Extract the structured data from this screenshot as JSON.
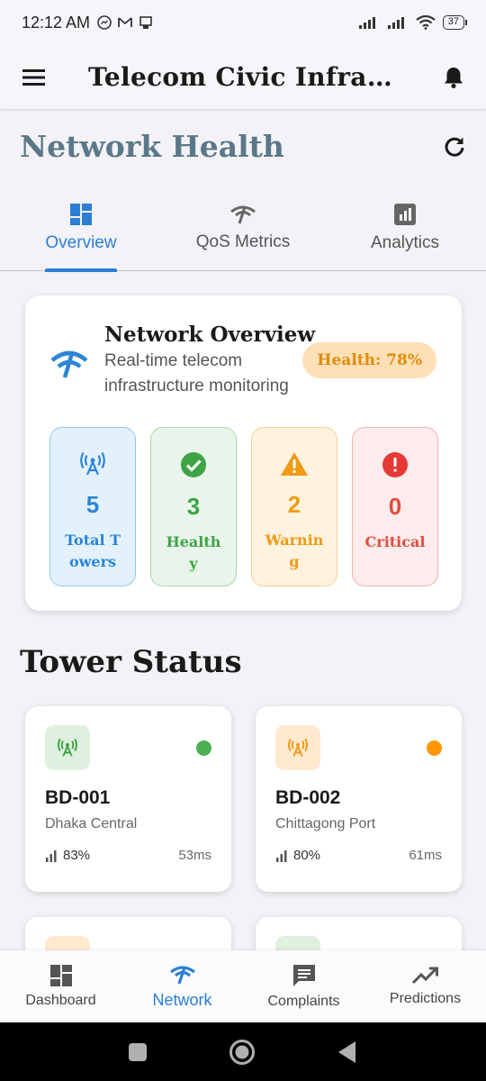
{
  "status_bar": {
    "time": "12:12 AM",
    "battery": "37"
  },
  "app_bar": {
    "title": "Telecom Civic Infrastr...",
    "menu_icon": "menu-icon",
    "bell_icon": "bell-icon"
  },
  "page": {
    "title": "Network Health",
    "refresh_icon": "refresh-icon"
  },
  "tabs": [
    {
      "label": "Overview",
      "icon": "dashboard-icon",
      "active": true
    },
    {
      "label": "QoS Metrics",
      "icon": "network-check-icon",
      "active": false
    },
    {
      "label": "Analytics",
      "icon": "analytics-icon",
      "active": false
    }
  ],
  "overview": {
    "title": "Network Overview",
    "subtitle": "Real-time telecom infrastructure monitoring",
    "health": "Health: 78%",
    "stats": [
      {
        "value": "5",
        "label": "Total Towers",
        "color": "#2a85d6"
      },
      {
        "value": "3",
        "label": "Healthy",
        "color": "#3da345"
      },
      {
        "value": "2",
        "label": "Warning",
        "color": "#f09a12"
      },
      {
        "value": "0",
        "label": "Critical",
        "color": "#e24c40"
      }
    ]
  },
  "tower_section": {
    "title": "Tower Status"
  },
  "towers": [
    {
      "id": "BD-001",
      "location": "Dhaka Central",
      "signal": "83%",
      "latency": "53ms",
      "status_color": "#4caf50"
    },
    {
      "id": "BD-002",
      "location": "Chittagong Port",
      "signal": "80%",
      "latency": "61ms",
      "status_color": "#ff9800"
    }
  ],
  "bottom_nav": [
    {
      "label": "Dashboard",
      "icon": "dashboard-icon",
      "active": false
    },
    {
      "label": "Network",
      "icon": "network-icon",
      "active": true
    },
    {
      "label": "Complaints",
      "icon": "feedback-icon",
      "active": false
    },
    {
      "label": "Predictions",
      "icon": "trending-up-icon",
      "active": false
    }
  ]
}
